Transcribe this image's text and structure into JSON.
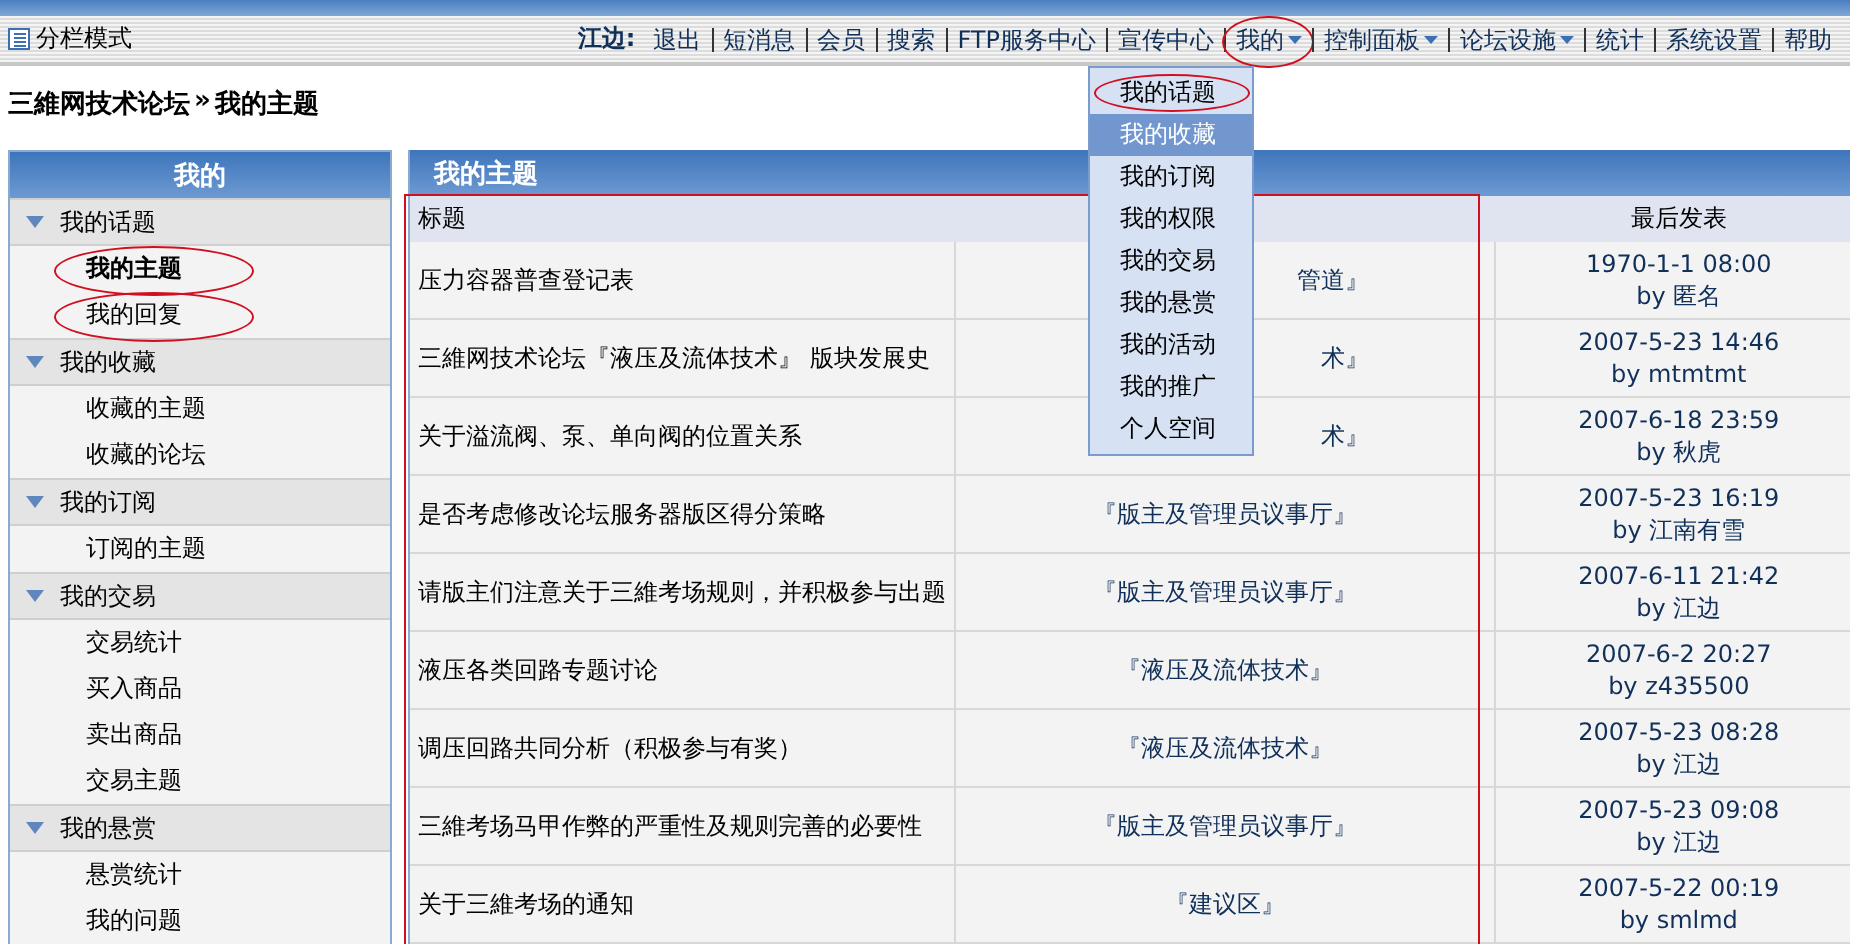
{
  "toolbar": {
    "mode_label": "分栏模式",
    "user": "江边:",
    "nav": [
      {
        "label": "退出",
        "has_menu": false,
        "circled": false
      },
      {
        "label": "短消息",
        "has_menu": false,
        "circled": false
      },
      {
        "label": "会员",
        "has_menu": false,
        "circled": false
      },
      {
        "label": "搜索",
        "has_menu": false,
        "circled": false
      },
      {
        "label": "FTP服务中心",
        "has_menu": false,
        "circled": false
      },
      {
        "label": "宣传中心",
        "has_menu": false,
        "circled": false
      },
      {
        "label": "我的",
        "has_menu": true,
        "circled": true
      },
      {
        "label": "控制面板",
        "has_menu": true,
        "circled": false
      },
      {
        "label": "论坛设施",
        "has_menu": true,
        "circled": false
      },
      {
        "label": "统计",
        "has_menu": false,
        "circled": false
      },
      {
        "label": "系统设置",
        "has_menu": false,
        "circled": false
      },
      {
        "label": "帮助",
        "has_menu": false,
        "circled": false
      }
    ]
  },
  "dropdown": {
    "items": [
      {
        "label": "我的话题",
        "selected": false,
        "circled": true
      },
      {
        "label": "我的收藏",
        "selected": true,
        "circled": false
      },
      {
        "label": "我的订阅",
        "selected": false,
        "circled": false
      },
      {
        "label": "我的权限",
        "selected": false,
        "circled": false
      },
      {
        "label": "我的交易",
        "selected": false,
        "circled": false
      },
      {
        "label": "我的悬赏",
        "selected": false,
        "circled": false
      },
      {
        "label": "我的活动",
        "selected": false,
        "circled": false
      },
      {
        "label": "我的推广",
        "selected": false,
        "circled": false
      },
      {
        "label": "个人空间",
        "selected": false,
        "circled": false
      }
    ]
  },
  "breadcrumb": {
    "forum": "三維网技术论坛",
    "separator": "»",
    "current": "我的主题"
  },
  "sidebar": {
    "title": "我的",
    "groups": [
      {
        "label": "我的话题",
        "expanded": true,
        "children": [
          {
            "label": "我的主题",
            "selected": true,
            "circled": true
          },
          {
            "label": "我的回复",
            "selected": false,
            "circled": true
          }
        ]
      },
      {
        "label": "我的收藏",
        "expanded": true,
        "children": [
          {
            "label": "收藏的主题",
            "selected": false,
            "circled": false
          },
          {
            "label": "收藏的论坛",
            "selected": false,
            "circled": false
          }
        ]
      },
      {
        "label": "我的订阅",
        "expanded": true,
        "children": [
          {
            "label": "订阅的主题",
            "selected": false,
            "circled": false
          }
        ]
      },
      {
        "label": "我的交易",
        "expanded": true,
        "children": [
          {
            "label": "交易统计",
            "selected": false,
            "circled": false
          },
          {
            "label": "买入商品",
            "selected": false,
            "circled": false
          },
          {
            "label": "卖出商品",
            "selected": false,
            "circled": false
          },
          {
            "label": "交易主题",
            "selected": false,
            "circled": false
          }
        ]
      },
      {
        "label": "我的悬赏",
        "expanded": true,
        "children": [
          {
            "label": "悬赏统计",
            "selected": false,
            "circled": false
          },
          {
            "label": "我的问题",
            "selected": false,
            "circled": false
          }
        ]
      }
    ]
  },
  "table": {
    "title": "我的主题",
    "framed": true,
    "columns": [
      "标题",
      "最后发表"
    ],
    "rows": [
      {
        "title": "压力容器普查登记表",
        "forum": "管道』",
        "covered": true,
        "last_time": "1970-1-1 08:00",
        "last_by": "by 匿名"
      },
      {
        "title": "三維网技术论坛『液压及流体技术』 版块发展史",
        "forum": "术』",
        "covered": true,
        "last_time": "2007-5-23 14:46",
        "last_by": "by mtmtmt"
      },
      {
        "title": "关于溢流阀、泵、单向阀的位置关系",
        "forum": "术』",
        "covered": true,
        "last_time": "2007-6-18 23:59",
        "last_by": "by 秋虎"
      },
      {
        "title": "是否考虑修改论坛服务器版区得分策略",
        "forum": "『版主及管理员议事厅』",
        "covered": false,
        "last_time": "2007-5-23 16:19",
        "last_by": "by 江南有雪"
      },
      {
        "title": "请版主们注意关于三維考场规则，并积极参与出题",
        "forum": "『版主及管理员议事厅』",
        "covered": false,
        "last_time": "2007-6-11 21:42",
        "last_by": "by 江边"
      },
      {
        "title": "液压各类回路专题讨论",
        "forum": "『液压及流体技术』",
        "covered": false,
        "last_time": "2007-6-2 20:27",
        "last_by": "by z435500"
      },
      {
        "title": "调压回路共同分析（积极参与有奖）",
        "forum": "『液压及流体技术』",
        "covered": false,
        "last_time": "2007-5-23 08:28",
        "last_by": "by 江边"
      },
      {
        "title": "三維考场马甲作弊的严重性及规则完善的必要性",
        "forum": "『版主及管理员议事厅』",
        "covered": false,
        "last_time": "2007-5-23 09:08",
        "last_by": "by 江边"
      },
      {
        "title": "关于三維考场的通知",
        "forum": "『建议区』",
        "covered": false,
        "last_time": "2007-5-22 00:19",
        "last_by": "by smlmd"
      }
    ]
  }
}
